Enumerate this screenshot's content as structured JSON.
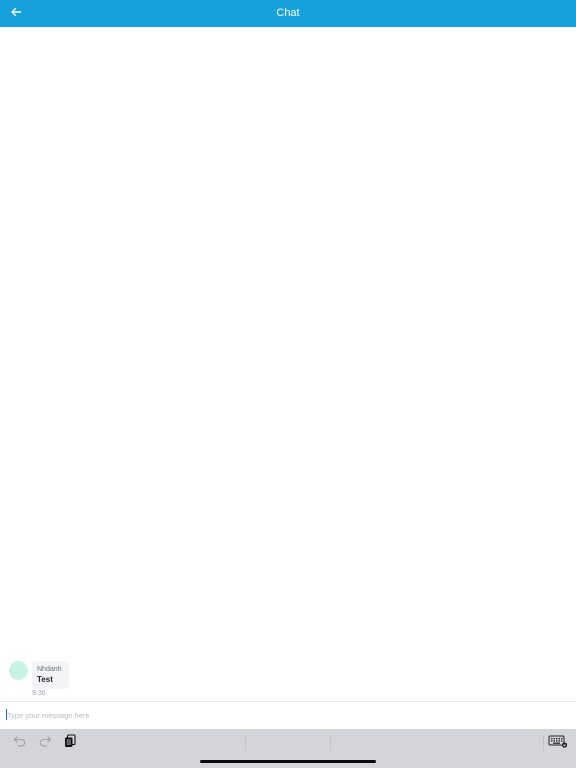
{
  "header": {
    "title": "Chat",
    "back_icon": "arrow-left-icon",
    "background_color": "#16a0dc"
  },
  "messages": [
    {
      "sender": "Nhdanh",
      "text": "Test",
      "time": "9:36",
      "avatar_color": "#c9f2e6"
    }
  ],
  "composer": {
    "placeholder": "Type your message here",
    "value": ""
  },
  "keyboard_bar": {
    "undo_icon": "undo-icon",
    "redo_icon": "redo-icon",
    "paste_icon": "paste-icon",
    "keyboard_icon": "keyboard-icon"
  }
}
